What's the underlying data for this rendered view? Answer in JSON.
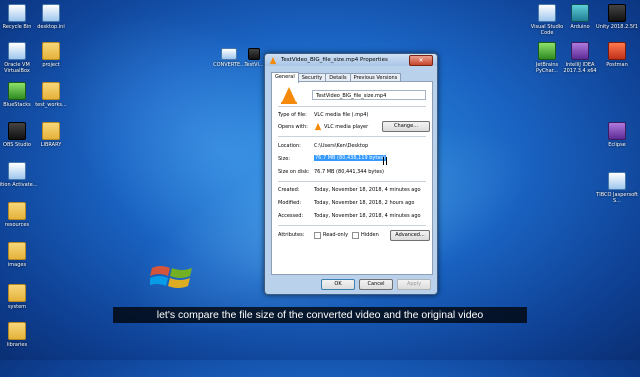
{
  "desktop": {
    "left_icons": [
      {
        "label": "Recycle Bin",
        "icon": "recycle-bin-icon",
        "style": "app"
      },
      {
        "label": "desktop.ini",
        "icon": "ini-file-icon",
        "style": "app"
      },
      {
        "label": "Oracle VM VirtualBox",
        "icon": "virtualbox-icon",
        "style": "app"
      },
      {
        "label": "project",
        "icon": "folder-icon",
        "style": "folder"
      },
      {
        "label": "BlueStacks",
        "icon": "bluestacks-icon",
        "style": "green"
      },
      {
        "label": "test_works...",
        "icon": "folder-icon",
        "style": "folder"
      },
      {
        "label": "OBS Studio",
        "icon": "obs-icon",
        "style": "dark"
      },
      {
        "label": "LIBRARY",
        "icon": "folder-icon",
        "style": "folder"
      },
      {
        "label": "Sition Activate...",
        "icon": "app-icon",
        "style": "app"
      },
      {
        "label": "resources",
        "icon": "folder-icon",
        "style": "folder"
      },
      {
        "label": "images",
        "icon": "folder-icon",
        "style": "folder"
      },
      {
        "label": "system",
        "icon": "folder-icon",
        "style": "folder"
      },
      {
        "label": "libraries",
        "icon": "folder-icon",
        "style": "folder"
      }
    ],
    "right_icons": [
      {
        "label": "Visual Studio Code",
        "icon": "vscode-icon",
        "style": "app"
      },
      {
        "label": "Arduino",
        "icon": "arduino-icon",
        "style": "teal"
      },
      {
        "label": "Unity 2018.2.5f1",
        "icon": "unity-icon",
        "style": "dark"
      },
      {
        "label": "JetBrains PyChar...",
        "icon": "pycharm-icon",
        "style": "green"
      },
      {
        "label": "IntelliJ IDEA 2017.3.4 x64",
        "icon": "intellij-icon",
        "style": "purple"
      },
      {
        "label": "Postman",
        "icon": "postman-icon",
        "style": "red"
      },
      {
        "label": "Eclipse",
        "icon": "eclipse-icon",
        "style": "purple"
      },
      {
        "label": "TIBCO Jaspersoft S...",
        "icon": "jaspersoft-icon",
        "style": "app"
      }
    ],
    "top_icons": [
      {
        "label": "CONVERTE...",
        "icon": "video-file-icon"
      },
      {
        "label": "TestVi...",
        "icon": "video-file-icon"
      }
    ]
  },
  "dialog": {
    "title": "TestVideo_BIG_file_size.mp4 Properties",
    "close_label": "✕",
    "tabs": [
      "General",
      "Security",
      "Details",
      "Previous Versions"
    ],
    "filename": "TestVideo_BIG_file_size.mp4",
    "type_label": "Type of file:",
    "type_value": "VLC media file (.mp4)",
    "opens_label": "Opens with:",
    "opens_value": "VLC media player",
    "change_label": "Change...",
    "location_label": "Location:",
    "location_value": "C:\\Users\\Ken\\Desktop",
    "size_label": "Size:",
    "size_value": "76.7 MB (80,438,119 bytes)",
    "size_disk_label": "Size on disk:",
    "size_disk_value": "76.7 MB (80,441,344 bytes)",
    "created_label": "Created:",
    "created_value": "Today, November 18, 2018, 4 minutes ago",
    "modified_label": "Modified:",
    "modified_value": "Today, November 18, 2018, 2 hours ago",
    "accessed_label": "Accessed:",
    "accessed_value": "Today, November 18, 2018, 4 minutes ago",
    "attributes_label": "Attributes:",
    "readonly_label": "Read-only",
    "hidden_label": "Hidden",
    "advanced_label": "Advanced...",
    "ok_label": "OK",
    "cancel_label": "Cancel",
    "apply_label": "Apply"
  },
  "caption": "let's compare the file size of the converted video and the original video"
}
